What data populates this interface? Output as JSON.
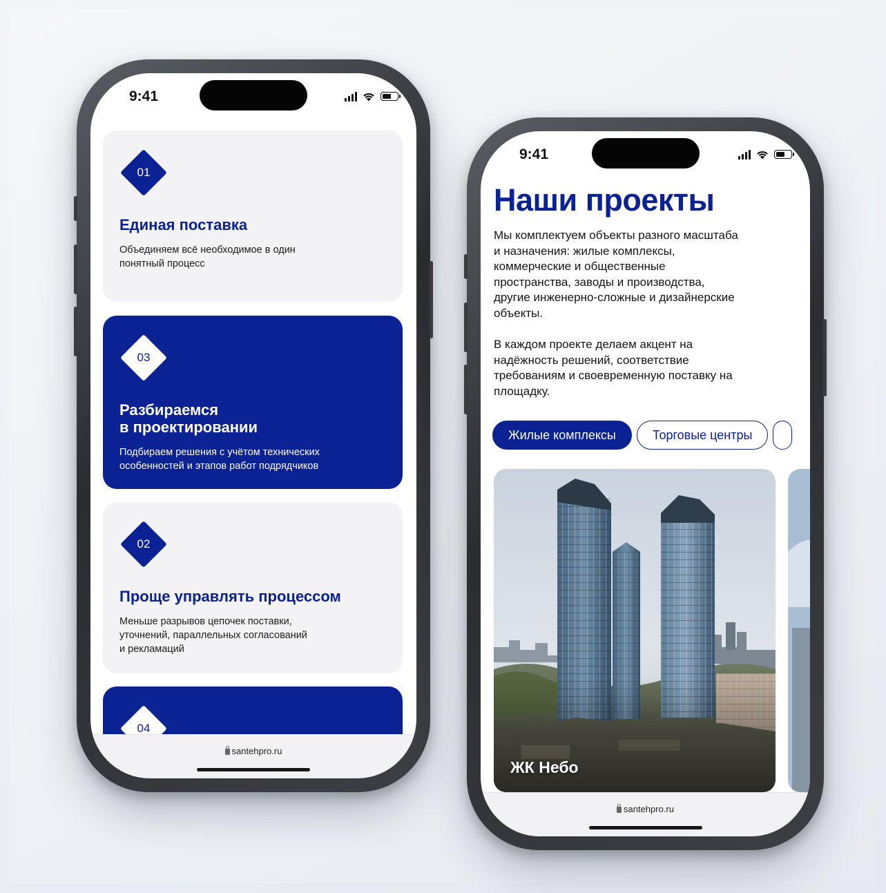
{
  "colors": {
    "brand_blue": "#0b2294",
    "card_light": "#f3f3f5",
    "background": "#eef0f4"
  },
  "status_bar": {
    "time": "9:41",
    "icons": [
      "cellular-signal-icon",
      "wifi-icon",
      "battery-icon"
    ]
  },
  "browser": {
    "url": "santehpro.ru",
    "icon": "lock-icon"
  },
  "left_phone": {
    "cards": [
      {
        "number": "01",
        "title": "Единая поставка",
        "description": "Объединяем всё необходимое в один\nпонятный процесс",
        "style": "light"
      },
      {
        "number": "03",
        "title": "Разбираемся\nв проектировании",
        "description": "Подбираем решения с учётом технических\nособенностей и этапов работ подрядчиков",
        "style": "dark"
      },
      {
        "number": "02",
        "title": "Проще управлять процессом",
        "description": "Меньше разрывов цепочек поставки,\nуточнений, параллельных согласований\nи рекламаций",
        "style": "light"
      },
      {
        "number": "04",
        "title": "",
        "description": "",
        "style": "dark"
      }
    ]
  },
  "right_phone": {
    "title": "Наши проекты",
    "intro": "Мы комплектуем объекты разного масштаба\nи назначения: жилые комплексы,\nкоммерческие и общественные\nпространства, заводы и производства,\nдругие инженерно-сложные и дизайнерские\nобъекты.\n\nВ каждом проекте делаем акцент на\nнадёжность решений, соответствие\nтребованиям и своевременную поставку на\nплощадку.",
    "filters": [
      {
        "label": "Жилые комплексы",
        "active": true
      },
      {
        "label": "Торговые центры",
        "active": false
      }
    ],
    "projects": [
      {
        "name": "ЖК Небо",
        "image": "twin-skyscrapers-photo"
      }
    ]
  }
}
